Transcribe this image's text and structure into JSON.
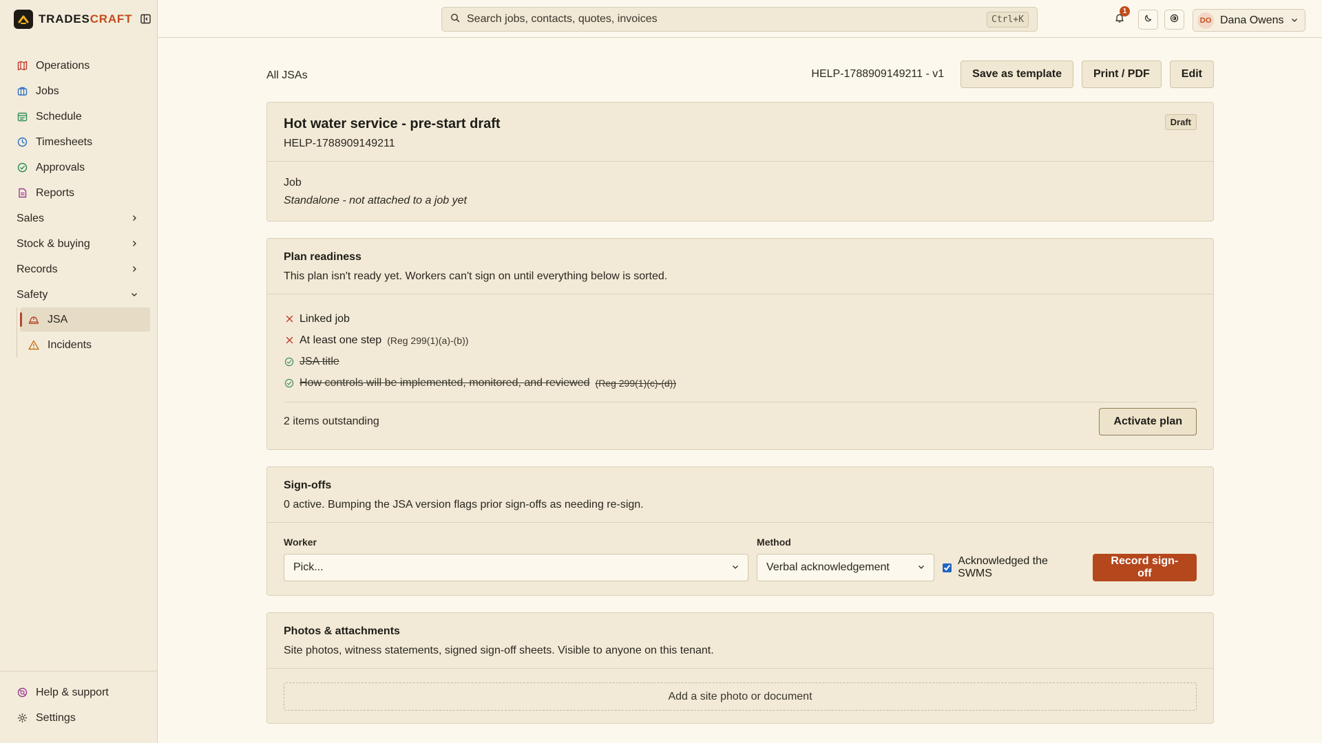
{
  "brand": {
    "name_part1": "TRADES",
    "name_part2": "CRAFT"
  },
  "sidebar": {
    "items": [
      {
        "label": "Operations",
        "icon": "map-icon",
        "color": "#c0392b"
      },
      {
        "label": "Jobs",
        "icon": "briefcase-icon",
        "color": "#2e6fc2"
      },
      {
        "label": "Schedule",
        "icon": "calendar-icon",
        "color": "#2e8b57"
      },
      {
        "label": "Timesheets",
        "icon": "clock-icon",
        "color": "#2e6fc2"
      },
      {
        "label": "Approvals",
        "icon": "check-circle-icon",
        "color": "#2e8b57"
      },
      {
        "label": "Reports",
        "icon": "file-icon",
        "color": "#9b3d8f"
      }
    ],
    "groups": [
      {
        "label": "Sales",
        "state": "collapsed"
      },
      {
        "label": "Stock & buying",
        "state": "collapsed"
      },
      {
        "label": "Records",
        "state": "collapsed"
      },
      {
        "label": "Safety",
        "state": "expanded"
      }
    ],
    "safety_items": [
      {
        "label": "JSA",
        "icon": "hard-hat-icon",
        "active": true
      },
      {
        "label": "Incidents",
        "icon": "warning-icon",
        "active": false
      }
    ],
    "bottom": [
      {
        "label": "Help & support",
        "icon": "help-icon"
      },
      {
        "label": "Settings",
        "icon": "gear-icon"
      }
    ]
  },
  "topbar": {
    "search_placeholder": "Search jobs, contacts, quotes, invoices",
    "search_shortcut": "Ctrl+K",
    "notification_count": "1",
    "user_initials": "DO",
    "user_name": "Dana Owens"
  },
  "page": {
    "breadcrumb": "All JSAs",
    "reference": "HELP-1788909149211 - v1",
    "actions": {
      "save_template": "Save as template",
      "print": "Print / PDF",
      "edit": "Edit"
    }
  },
  "jsa": {
    "title": "Hot water service - pre-start draft",
    "ref": "HELP-1788909149211",
    "status": "Draft",
    "job_label": "Job",
    "job_value": "Standalone - not attached to a job yet"
  },
  "readiness": {
    "title": "Plan readiness",
    "subtitle": "This plan isn't ready yet. Workers can't sign on until everything below is sorted.",
    "checks": [
      {
        "label": "Linked job",
        "reg": "",
        "done": false
      },
      {
        "label": "At least one step",
        "reg": "(Reg 299(1)(a)-(b))",
        "done": false
      },
      {
        "label": "JSA title",
        "reg": "",
        "done": true
      },
      {
        "label": "How controls will be implemented, monitored, and reviewed",
        "reg": "(Reg 299(1)(c)-(d))",
        "done": true
      }
    ],
    "outstanding": "2 items outstanding",
    "activate_label": "Activate plan"
  },
  "signoffs": {
    "title": "Sign-offs",
    "subtitle": "0 active. Bumping the JSA version flags prior sign-offs as needing re-sign.",
    "worker_label": "Worker",
    "worker_value": "Pick...",
    "method_label": "Method",
    "method_value": "Verbal acknowledgement",
    "ack_label": "Acknowledged the SWMS",
    "ack_checked": true,
    "record_label": "Record sign-off"
  },
  "attachments": {
    "title": "Photos & attachments",
    "subtitle": "Site photos, witness statements, signed sign-off sheets. Visible to anyone on this tenant.",
    "add_label": "Add a site photo or document"
  },
  "colors": {
    "accent": "#c24d1c",
    "primary_button": "#b5471c",
    "background": "#fcf8ee",
    "card": "#f2ead7"
  }
}
